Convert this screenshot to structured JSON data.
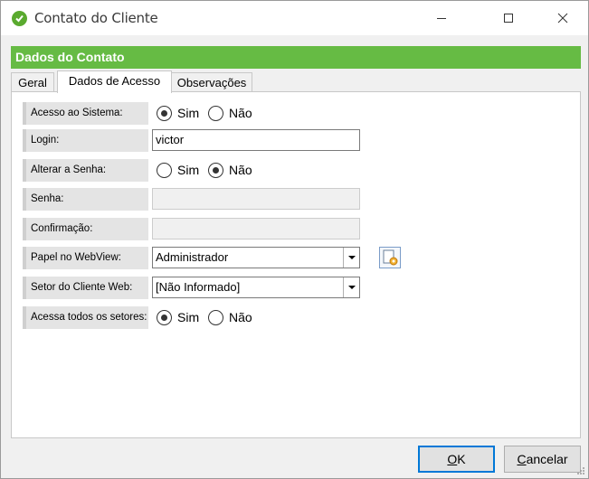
{
  "window": {
    "title": "Contato do Cliente"
  },
  "header": {
    "title": "Dados do Contato"
  },
  "tabs": [
    {
      "label": "Geral",
      "active": false
    },
    {
      "label": "Dados de Acesso",
      "active": true
    },
    {
      "label": "Observações",
      "active": false
    }
  ],
  "form": {
    "acesso_sistema": {
      "label": "Acesso ao Sistema:",
      "options": [
        "Sim",
        "Não"
      ],
      "selected": "Sim"
    },
    "login": {
      "label": "Login:",
      "value": "victor"
    },
    "alterar_senha": {
      "label": "Alterar a Senha:",
      "options": [
        "Sim",
        "Não"
      ],
      "selected": "Não"
    },
    "senha": {
      "label": "Senha:",
      "value": ""
    },
    "confirmacao": {
      "label": "Confirmação:",
      "value": ""
    },
    "papel_webview": {
      "label": "Papel no WebView:",
      "value": "Administrador"
    },
    "setor_cliente_web": {
      "label": "Setor do Cliente Web:",
      "value": "[Não Informado]"
    },
    "acessa_setores": {
      "label": "Acessa todos os setores:",
      "options": [
        "Sim",
        "Não"
      ],
      "selected": "Sim"
    }
  },
  "buttons": {
    "ok": "OK",
    "cancel": "Cancelar"
  },
  "colors": {
    "header": "#66bb44",
    "app_icon": "#5aaa2f",
    "ok_border": "#0078d7"
  },
  "icons": {
    "app": "check-circle-icon",
    "edit": "edit-document-icon",
    "minimize": "minimize-icon",
    "maximize": "maximize-icon",
    "close": "close-icon"
  }
}
